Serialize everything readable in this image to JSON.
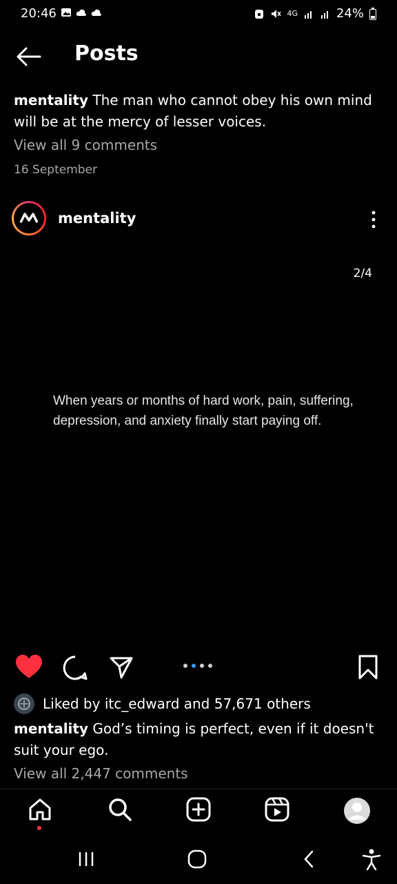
{
  "status_bar": {
    "time": "20:46",
    "network": "4G",
    "battery": "24%"
  },
  "header": {
    "title": "Posts"
  },
  "previous_post": {
    "username": "mentality",
    "caption": "The man who cannot obey his own mind will be at the mercy of lesser voices.",
    "view_comments": "View all 9 comments",
    "date": "16 September"
  },
  "post": {
    "username": "mentality",
    "slide_counter": "2/4",
    "image_text": "When years or months of hard work, pain, suffering, depression, and anxiety finally start paying off.",
    "liked_by_text": "Liked by itc_edward and 57,671 others",
    "caption_username": "mentality",
    "caption": "God’s timing is perfect, even if it doesn't suit your ego.",
    "view_comments": "View all 2,447 comments",
    "carousel": {
      "total": 4,
      "active": 2
    },
    "liked": true
  },
  "colors": {
    "background": "#000000",
    "like_red": "#ff3040",
    "active_dot": "#3897f0"
  },
  "bottom_nav": [
    "home-icon",
    "search-icon",
    "create-icon",
    "reels-icon",
    "profile-icon"
  ],
  "system_nav": [
    "recents-icon",
    "home-button-icon",
    "back-icon",
    "accessibility-icon"
  ]
}
